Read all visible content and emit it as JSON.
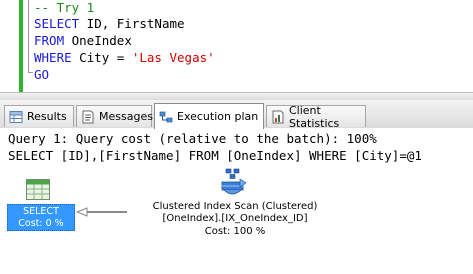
{
  "editor": {
    "lines": [
      {
        "comment": "-- Try 1"
      },
      {
        "kw1": "SELECT",
        "rest": " ID, FirstName"
      },
      {
        "kw1": "FROM",
        "rest": " OneIndex"
      },
      {
        "kw1": "WHERE",
        "rest": " City ",
        "op": "=",
        "str": "'Las Vegas'"
      },
      {
        "kw1": "GO"
      }
    ]
  },
  "tabs": [
    {
      "label": "Results",
      "icon": "results-grid-icon"
    },
    {
      "label": "Messages",
      "icon": "messages-icon"
    },
    {
      "label": "Execution plan",
      "icon": "execution-plan-icon",
      "active": true
    },
    {
      "label": "Client Statistics",
      "icon": "client-statistics-icon"
    }
  ],
  "plan": {
    "query_header": "Query 1: Query cost (relative to the batch): 100%",
    "query_text": "SELECT [ID],[FirstName] FROM [OneIndex] WHERE [City]=@1",
    "select_node": {
      "label": "SELECT",
      "cost": "Cost: 0 %",
      "icon": "select-operator-icon"
    },
    "scan_node": {
      "label": "Clustered Index Scan (Clustered)",
      "object": "[OneIndex].[IX_OneIndex_ID]",
      "cost": "Cost: 100 %",
      "icon": "clustered-index-scan-icon"
    }
  },
  "colors": {
    "keyword": "#1a1adb",
    "comment": "#1a8a1a",
    "string": "#d00000",
    "selected_node": "#3399ff",
    "change_bar": "#2db52d"
  }
}
